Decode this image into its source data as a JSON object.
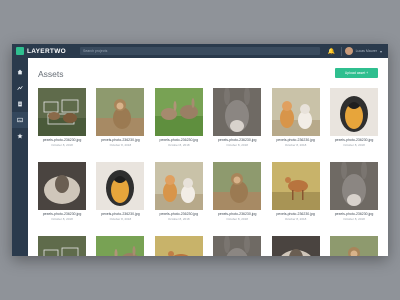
{
  "app": {
    "brand": "LAYERTWO"
  },
  "topbar": {
    "search_placeholder": "Search projects",
    "user_name": "Lucas Maurer"
  },
  "sidebar": {
    "items": [
      {
        "icon": "home-icon",
        "active": false
      },
      {
        "icon": "chart-icon",
        "active": false
      },
      {
        "icon": "document-icon",
        "active": false
      },
      {
        "icon": "image-icon",
        "active": true
      },
      {
        "icon": "star-icon",
        "active": false
      }
    ]
  },
  "page": {
    "title": "Assets",
    "upload_label": "Upload asset +"
  },
  "assets": [
    {
      "name": "pexels-photo-236230.jpg",
      "date": "October 8, 2018",
      "subject": "bears sketch"
    },
    {
      "name": "pexels-photo-236230.jpg",
      "date": "October 8, 2018",
      "subject": "monkey"
    },
    {
      "name": "pexels-photo-236230.jpg",
      "date": "October 8, 2018",
      "subject": "rabbits"
    },
    {
      "name": "pexels-photo-236230.jpg",
      "date": "October 8, 2018",
      "subject": "donkey"
    },
    {
      "name": "pexels-photo-236230.jpg",
      "date": "October 8, 2018",
      "subject": "kittens"
    },
    {
      "name": "pexels-photo-236230.jpg",
      "date": "October 8, 2018",
      "subject": "parrot"
    },
    {
      "name": "pexels-photo-236230.jpg",
      "date": "October 8, 2018",
      "subject": "sheep"
    },
    {
      "name": "pexels-photo-236230.jpg",
      "date": "October 8, 2018",
      "subject": "parrot"
    },
    {
      "name": "pexels-photo-236230.jpg",
      "date": "October 8, 2018",
      "subject": "kittens"
    },
    {
      "name": "pexels-photo-236230.jpg",
      "date": "October 8, 2018",
      "subject": "monkey"
    },
    {
      "name": "pexels-photo-236230.jpg",
      "date": "October 8, 2018",
      "subject": "antelope"
    },
    {
      "name": "pexels-photo-236230.jpg",
      "date": "October 8, 2018",
      "subject": "donkey"
    },
    {
      "name": "",
      "date": "",
      "subject": "bears sketch"
    },
    {
      "name": "",
      "date": "",
      "subject": "rabbits"
    },
    {
      "name": "",
      "date": "",
      "subject": "antelope"
    },
    {
      "name": "",
      "date": "",
      "subject": "donkey"
    },
    {
      "name": "",
      "date": "",
      "subject": "sheep"
    },
    {
      "name": "",
      "date": "",
      "subject": "monkey"
    }
  ]
}
